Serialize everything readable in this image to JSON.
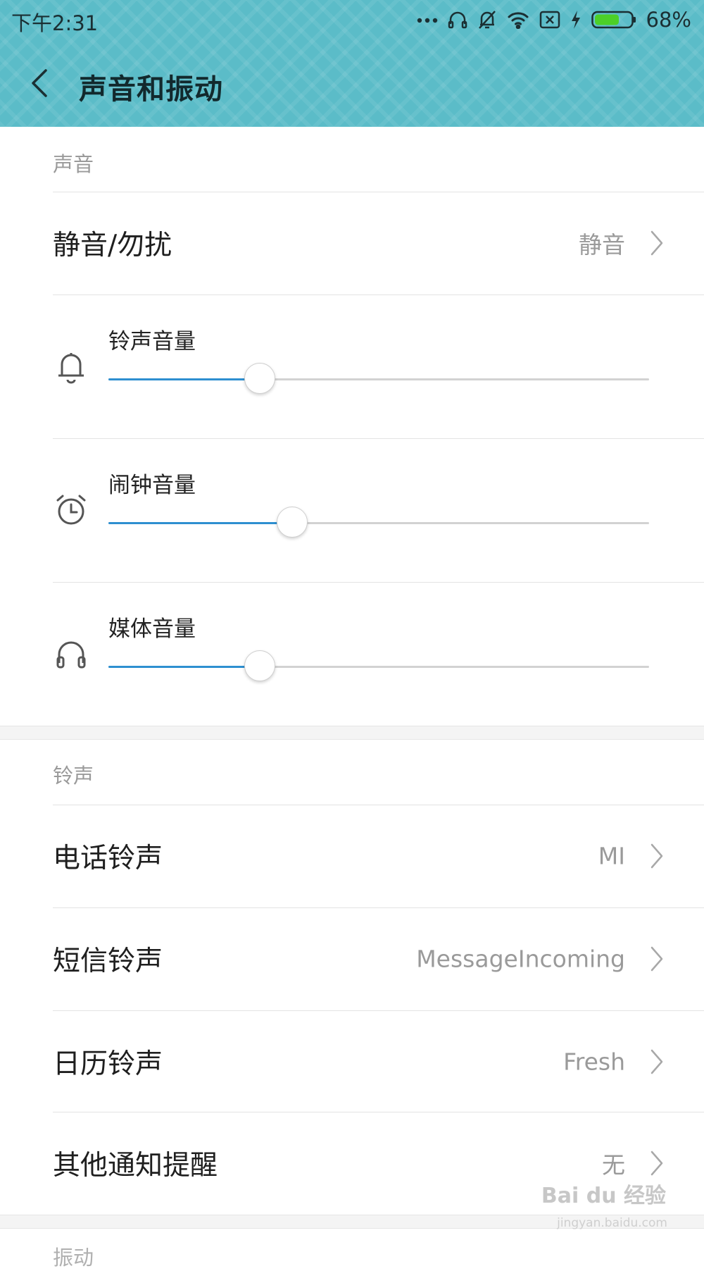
{
  "status_bar": {
    "time": "下午2:31",
    "battery_percent": "68%",
    "battery_level": 0.68,
    "icons": [
      "more-dots-icon",
      "headset-icon",
      "bell-off-icon",
      "wifi-icon",
      "sim-x-icon",
      "charging-bolt-icon",
      "battery-icon"
    ]
  },
  "header": {
    "title": "声音和振动",
    "back_icon": "chevron-left-icon",
    "background_color": "#5bbcc8"
  },
  "sound_section": {
    "header": "声音",
    "dnd_row": {
      "label": "静音/勿扰",
      "value": "静音"
    },
    "sliders": [
      {
        "label": "铃声音量",
        "icon": "bell-icon",
        "level": 0.28
      },
      {
        "label": "闹钟音量",
        "icon": "alarm-clock-icon",
        "level": 0.34
      },
      {
        "label": "媒体音量",
        "icon": "headphones-icon",
        "level": 0.28
      }
    ],
    "accent_color": "#2e8fd0"
  },
  "ringtone_section": {
    "header": "铃声",
    "rows": [
      {
        "label": "电话铃声",
        "value": "MI"
      },
      {
        "label": "短信铃声",
        "value": "MessageIncoming"
      },
      {
        "label": "日历铃声",
        "value": "Fresh"
      },
      {
        "label": "其他通知提醒",
        "value": "无"
      }
    ]
  },
  "next_section": {
    "header_partial": "振动"
  },
  "watermark": {
    "text": "Bai du 经验",
    "sub": "jingyan.baidu.com"
  }
}
